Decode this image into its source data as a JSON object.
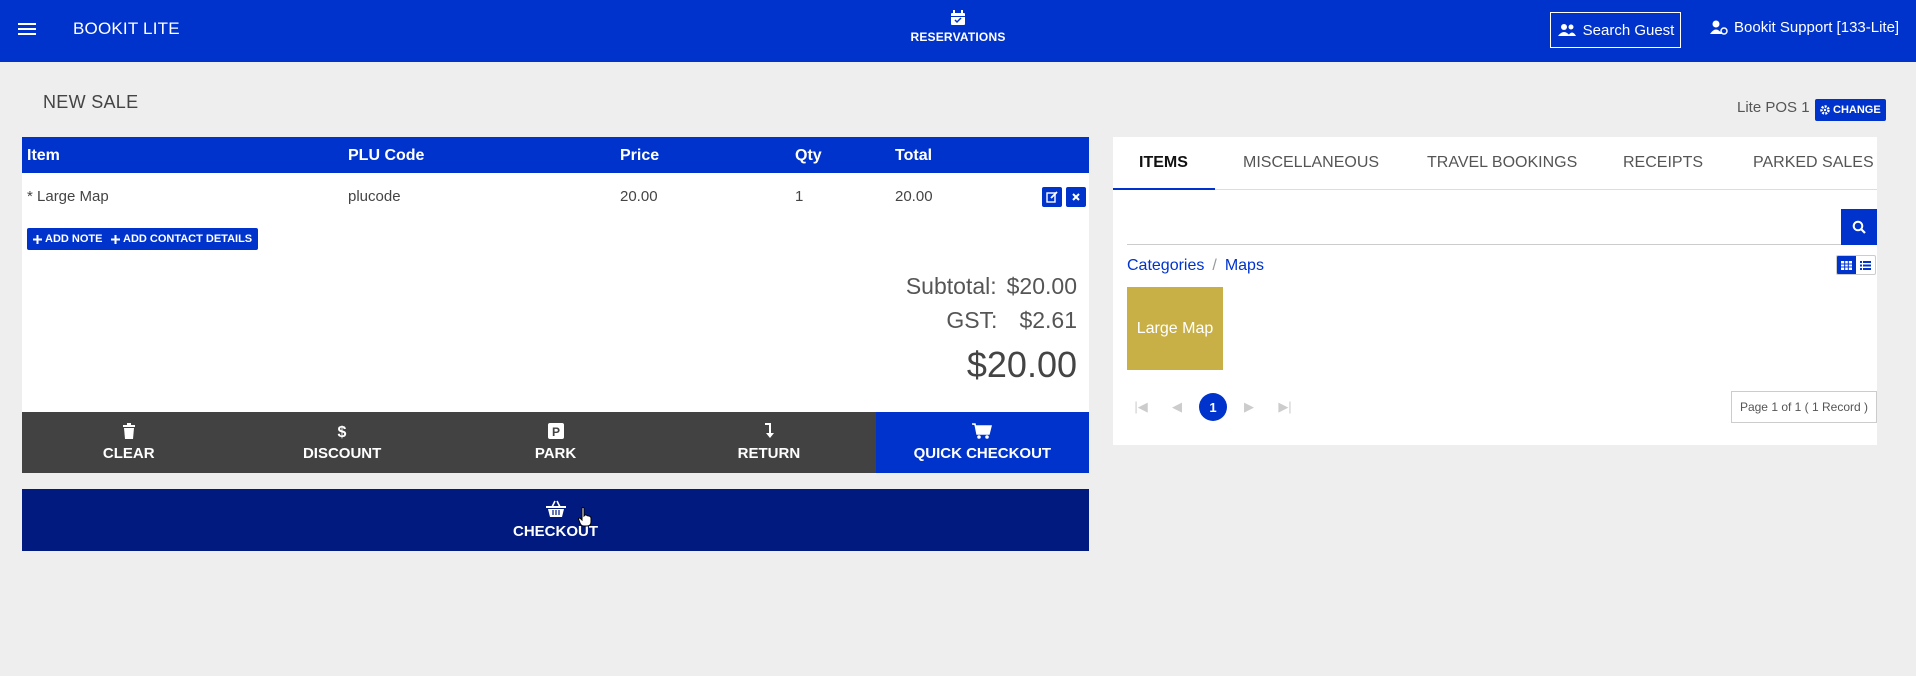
{
  "app": {
    "brand": "BOOKIT LITE"
  },
  "topbar": {
    "reservations_label": "RESERVATIONS",
    "search_guest_label": "Search Guest",
    "user_label": "Bookit Support [133-Lite]"
  },
  "page": {
    "title": "NEW SALE",
    "pos_label": "Lite POS 1",
    "change_label": "CHANGE"
  },
  "sale": {
    "columns": {
      "item": "Item",
      "plu": "PLU Code",
      "price": "Price",
      "qty": "Qty",
      "total": "Total"
    },
    "rows": [
      {
        "item": "* Large Map",
        "plu": "plucode",
        "price": "20.00",
        "qty": "1",
        "total": "20.00"
      }
    ],
    "add_note_label": "ADD NOTE",
    "add_contact_label": "ADD CONTACT DETAILS",
    "subtotal_label": "Subtotal:",
    "subtotal_value": "$20.00",
    "gst_label": "GST:",
    "gst_value": "$2.61",
    "grand_total": "$20.00"
  },
  "actions": {
    "clear": "CLEAR",
    "discount": "DISCOUNT",
    "park": "PARK",
    "return": "RETURN",
    "quick_checkout": "QUICK CHECKOUT",
    "checkout": "CHECKOUT"
  },
  "catalog": {
    "tabs": [
      "ITEMS",
      "MISCELLANEOUS",
      "TRAVEL BOOKINGS",
      "RECEIPTS",
      "PARKED SALES"
    ],
    "active_tab": "ITEMS",
    "search_value": "",
    "breadcrumb": [
      "Categories",
      "Maps"
    ],
    "tiles": [
      {
        "label": "Large Map",
        "color": "#c8b046"
      }
    ],
    "current_page": "1",
    "page_info": "Page 1 of 1 ( 1 Record )"
  },
  "colors": {
    "primary": "#0033cc",
    "dark_primary": "#001a80",
    "action_bar": "#424242",
    "background": "#eeeeee"
  }
}
